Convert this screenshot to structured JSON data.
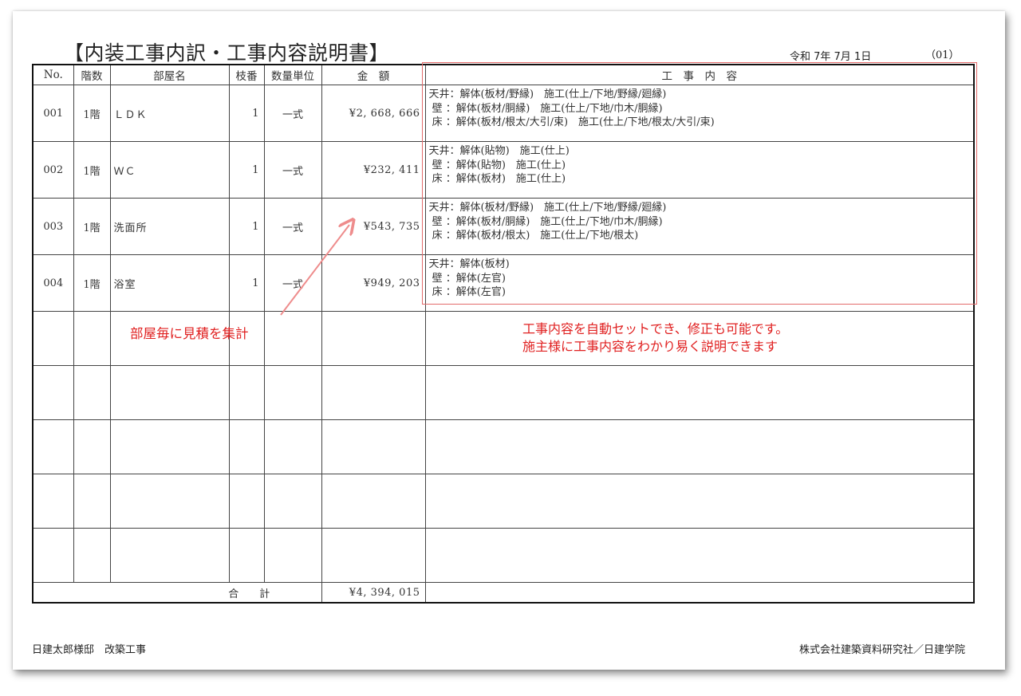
{
  "document": {
    "title": "【内装工事内訳・工事内容説明書】",
    "date": "令和 7年 7月 1日",
    "page_no": "（01）"
  },
  "table": {
    "headers": {
      "no": "No.",
      "floor": "階数",
      "room": "部屋名",
      "branch": "枝番",
      "qty_unit": "数量単位",
      "amount": "金　額",
      "content": "工　事　内　容"
    },
    "rows": [
      {
        "no": "001",
        "floor": "1階",
        "room": "ＬＤＫ",
        "branch": "1",
        "unit": "一式",
        "amount": "¥2, 668, 666",
        "lines": [
          "天井：解体(板材/野縁)　施工(仕上/下地/野縁/廻縁)",
          " 壁 ：解体(板材/胴縁)　施工(仕上/下地/巾木/胴縁)",
          " 床 ：解体(板材/根太/大引/束)　施工(仕上/下地/根太/大引/束)"
        ]
      },
      {
        "no": "002",
        "floor": "1階",
        "room": "ＷＣ",
        "branch": "1",
        "unit": "一式",
        "amount": "¥232, 411",
        "lines": [
          "天井：解体(貼物)　施工(仕上)",
          " 壁 ：解体(貼物)　施工(仕上)",
          " 床 ：解体(板材)　施工(仕上)"
        ]
      },
      {
        "no": "003",
        "floor": "1階",
        "room": "洗面所",
        "branch": "1",
        "unit": "一式",
        "amount": "¥543, 735",
        "lines": [
          "天井：解体(板材/野縁)　施工(仕上/下地/野縁/廻縁)",
          " 壁 ：解体(板材/胴縁)　施工(仕上/下地/巾木/胴縁)",
          " 床 ：解体(板材/根太)　施工(仕上/下地/根太)"
        ]
      },
      {
        "no": "004",
        "floor": "1階",
        "room": "浴室",
        "branch": "1",
        "unit": "一式",
        "amount": "¥949, 203",
        "lines": [
          "天井：解体(板材)",
          " 壁 ：解体(左官)",
          " 床 ：解体(左官)"
        ]
      }
    ],
    "total_label": "合　　計",
    "total_amount": "¥4, 394, 015"
  },
  "annotations": {
    "left_note": "部屋毎に見積を集計",
    "right_note_line1": "工事内容を自動セットでき、修正も可能です。",
    "right_note_line2": "施主様に工事内容をわかり易く説明できます",
    "accent_color": "#e02020",
    "box_color": "#e36b6b"
  },
  "footer": {
    "project": "日建太郎様邸　改築工事",
    "company": "株式会社建築資料研究社／日建学院"
  }
}
